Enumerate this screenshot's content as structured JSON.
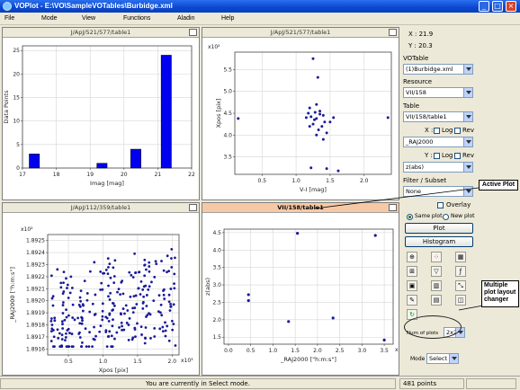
{
  "window": {
    "title": "VOPlot - E:\\VO\\SampleVOTables\\Burbidge.xml"
  },
  "menu": [
    "File",
    "Mode",
    "View",
    "Functions",
    "Aladin",
    "Help"
  ],
  "panels": [
    {
      "title": "J/ApJ/521/577/table1",
      "xlabel": "Imag [mag]",
      "ylabel": "Data Points",
      "x_ticks": [
        "17",
        "18",
        "19",
        "20",
        "21",
        "22"
      ],
      "y_ticks": [
        "0",
        "5",
        "10",
        "15",
        "20",
        "25"
      ]
    },
    {
      "title": "J/ApJ/521/577/table1",
      "xlabel": "V-I [mag]",
      "ylabel": "Xpos [pix]",
      "multiplier": "x10²",
      "x_ticks": [
        "0.5",
        "1.0",
        "1.5",
        "2.0"
      ],
      "y_ticks": [
        "3.5",
        "4.0",
        "4.5",
        "5.0",
        "5.5"
      ]
    },
    {
      "title": "J/ApJ/112/359/table1",
      "xlabel": "Xpos [pix]",
      "ylabel": "_RAJ2000 [\"h:m:s\"]",
      "multiplier": "x10²",
      "x_multiplier": "x10³",
      "x_ticks": [
        "0.5",
        "1.0",
        "1.5",
        "2.0"
      ],
      "y_ticks": [
        "1.8925",
        "1.8924",
        "1.8923",
        "1.8922",
        "1.8921",
        "1.8920",
        "1.8919",
        "1.8918",
        "1.8917",
        "1.8916"
      ]
    },
    {
      "title": "VII/158/table1",
      "xlabel": "_RAJ2000 [\"h:m:s\"]",
      "ylabel": "z(abs)",
      "x_multiplier": "x10²",
      "x_ticks": [
        "0.0",
        "0.5",
        "1.0",
        "1.5",
        "2.0",
        "2.5",
        "3.0",
        "3.5"
      ],
      "y_ticks": [
        "1.5",
        "2.0",
        "2.5",
        "3.0",
        "3.5",
        "4.0",
        "4.5"
      ]
    }
  ],
  "chart_data": [
    {
      "type": "bar",
      "title": "J/ApJ/521/577/table1",
      "xlabel": "Imag [mag]",
      "ylabel": "Data Points",
      "xlim": [
        17,
        22
      ],
      "ylim": [
        0,
        26
      ],
      "bins": [
        {
          "x0": 17.2,
          "x1": 17.5,
          "value": 3
        },
        {
          "x0": 19.2,
          "x1": 19.5,
          "value": 1
        },
        {
          "x0": 20.2,
          "x1": 20.5,
          "value": 4
        },
        {
          "x0": 21.1,
          "x1": 21.4,
          "value": 24
        }
      ]
    },
    {
      "type": "scatter",
      "title": "J/ApJ/521/577/table1",
      "xlabel": "V-I [mag]",
      "ylabel": "Xpos [pix]",
      "xlim": [
        0.1,
        2.4
      ],
      "ylim": [
        3.1,
        5.9
      ],
      "points": [
        [
          0.15,
          4.38
        ],
        [
          2.35,
          4.4
        ],
        [
          1.25,
          5.75
        ],
        [
          1.32,
          5.32
        ],
        [
          1.2,
          4.62
        ],
        [
          1.3,
          4.7
        ],
        [
          1.35,
          4.55
        ],
        [
          1.28,
          4.52
        ],
        [
          1.4,
          4.45
        ],
        [
          1.15,
          4.4
        ],
        [
          1.22,
          4.42
        ],
        [
          1.3,
          4.38
        ],
        [
          1.42,
          4.3
        ],
        [
          1.38,
          4.2
        ],
        [
          1.25,
          4.25
        ],
        [
          1.33,
          4.12
        ],
        [
          1.45,
          4.05
        ],
        [
          1.4,
          3.9
        ],
        [
          1.5,
          4.3
        ],
        [
          1.35,
          4.48
        ],
        [
          1.27,
          4.35
        ],
        [
          1.2,
          4.2
        ],
        [
          1.55,
          4.4
        ],
        [
          1.22,
          3.25
        ],
        [
          1.45,
          3.23
        ],
        [
          1.62,
          3.18
        ],
        [
          1.3,
          4.0
        ],
        [
          1.18,
          4.5
        ]
      ]
    },
    {
      "type": "scatter",
      "title": "J/ApJ/112/359/table1",
      "xlabel": "Xpos [pix]",
      "ylabel": "_RAJ2000 [\"h:m:s\"]",
      "xlim": [
        0.2,
        2.1
      ],
      "ylim": [
        1.89155,
        1.89255
      ],
      "generated": {
        "count": 281,
        "seed": 7,
        "x_range": [
          0.25,
          2.05
        ],
        "y_range": [
          1.89162,
          1.89252
        ]
      }
    },
    {
      "type": "scatter",
      "title": "VII/158/table1",
      "xlabel": "_RAJ2000 [\"h:m:s\"]",
      "ylabel": "z(abs)",
      "xlim": [
        -0.1,
        3.7
      ],
      "ylim": [
        1.3,
        4.6
      ],
      "points": [
        [
          0.45,
          2.72
        ],
        [
          0.45,
          2.55
        ],
        [
          1.35,
          1.95
        ],
        [
          1.55,
          4.48
        ],
        [
          2.35,
          2.05
        ],
        [
          3.3,
          4.42
        ],
        [
          3.5,
          1.42
        ]
      ]
    }
  ],
  "sidebar": {
    "x_readout": "X : 21.9",
    "y_readout": "Y : 20.3",
    "votable_label": "VOTable",
    "votable_value": "(1)Burbidge.xml",
    "resource_label": "Resource",
    "resource_value": "VII/158",
    "table_label": "Table",
    "table_value": "VII/158/table1",
    "x_axis_label": "X :",
    "log_label": "Log",
    "rev_label": "Rev",
    "x_axis_value": "_RAJ2000",
    "y_axis_label": "Y :",
    "y_axis_value": "z(abs)",
    "filter_label": "Filter / Subset",
    "filter_value": "None",
    "overlay_label": "Overlay",
    "same_plot_label": "Same plot",
    "new_plot_label": "New plot",
    "plot_button": "Plot",
    "histogram_button": "Histogram",
    "num_plots_label": "Num of plots",
    "num_plots_value": "2x2",
    "mode_label": "Mode",
    "mode_value": "Select"
  },
  "tools": [
    "globe-icon",
    "scatter-icon",
    "grid-icon",
    "zoom-in-icon",
    "filter-icon",
    "function-icon",
    "image-icon",
    "histogram-icon",
    "resize-icon",
    "edit-icon",
    "table-icon",
    "chart-icon",
    "refresh-icon"
  ],
  "status": {
    "message": "You are currently in Select mode.",
    "points": "481 points"
  },
  "annotations": {
    "active_plot": "Active Plot",
    "layout_changer": "Multiple plot layout changer"
  },
  "colors": {
    "point": "#1a1a99",
    "bar": "#0000ee",
    "active_title": "#f6c9a6",
    "titlebar": "#0a48d0"
  }
}
